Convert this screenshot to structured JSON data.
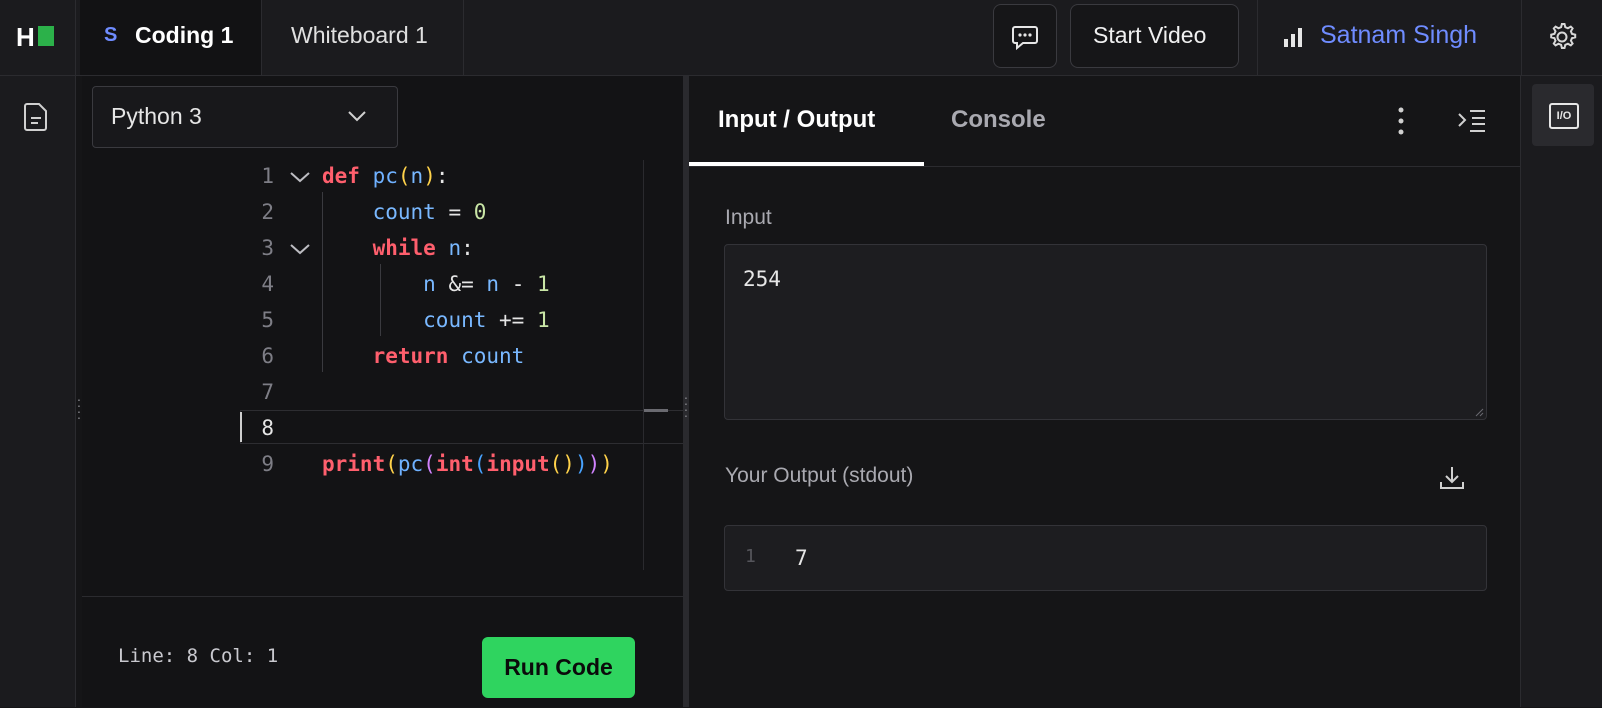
{
  "topbar": {
    "logo_letter": "H",
    "tabs": [
      {
        "badge": "S",
        "label": "Coding 1"
      },
      {
        "label": "Whiteboard 1"
      }
    ],
    "start_video_label": "Start Video",
    "user_name": "Satnam Singh"
  },
  "editor": {
    "language": "Python 3",
    "line_numbers": [
      "1",
      "2",
      "3",
      "4",
      "5",
      "6",
      "7",
      "8",
      "9"
    ],
    "code": {
      "l1_kw": "def",
      "l1_fn": "pc",
      "l1_open": "(",
      "l1_arg": "n",
      "l1_close": ")",
      "l1_colon": ":",
      "l2_var": "count",
      "l2_op": " = ",
      "l2_num": "0",
      "l3_kw": "while",
      "l3_var": "n",
      "l3_colon": ":",
      "l4_var1": "n",
      "l4_op": " &= ",
      "l4_var2": "n",
      "l4_op2": " - ",
      "l4_num": "1",
      "l5_var": "count",
      "l5_op": " += ",
      "l5_num": "1",
      "l6_kw": "return",
      "l6_var": "count",
      "l9_print": "print",
      "l9_po": "(",
      "l9_pc": "pc",
      "l9_po2": "(",
      "l9_int": "int",
      "l9_po3": "(",
      "l9_input": "input",
      "l9_po4": "()",
      "l9_pc3": ")",
      "l9_pc2": ")",
      "l9_pc1": ")"
    },
    "status": "Line: 8 Col: 1",
    "run_label": "Run Code"
  },
  "io": {
    "tabs": [
      "Input / Output",
      "Console"
    ],
    "input_label": "Input",
    "input_value": "254",
    "output_label": "Your Output (stdout)",
    "output_line_number": "1",
    "output_value": "7"
  },
  "rightrail": {
    "io_label": "I/O"
  },
  "colors": {
    "accent_green": "#2fd45f",
    "user_blue": "#6f8cff",
    "keyword": "#ff5f6d"
  }
}
